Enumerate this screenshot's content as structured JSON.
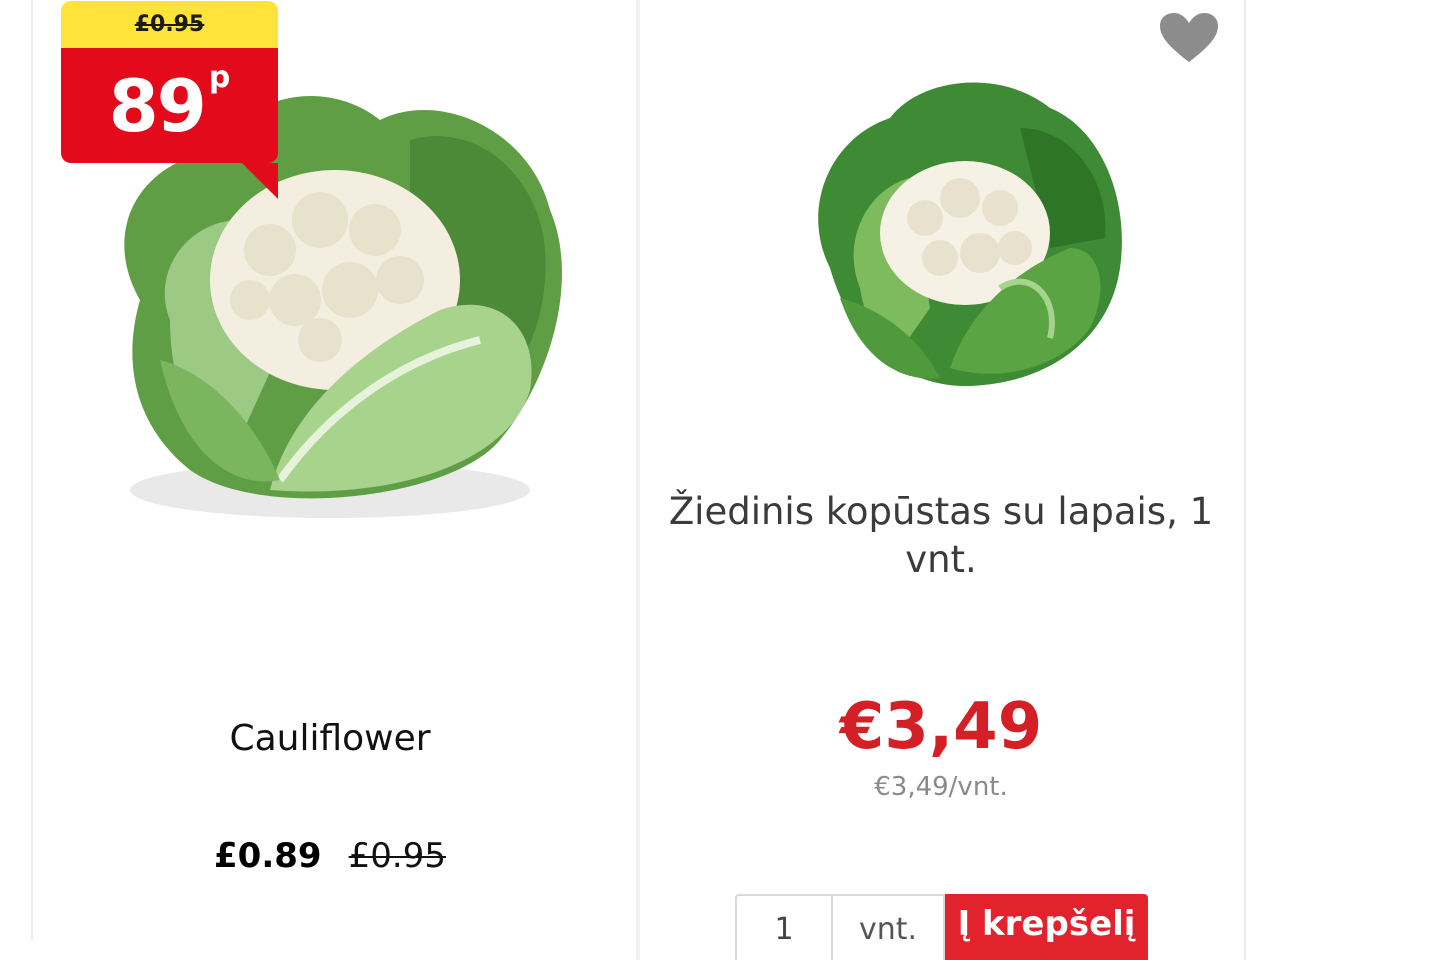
{
  "left_product": {
    "promo_badge": {
      "old_price": "£0.95",
      "price_number": "89",
      "price_unit": "p"
    },
    "image_icon": "cauliflower-photo",
    "title": "Cauliflower",
    "price_now": "£0.89",
    "price_was": "£0.95"
  },
  "right_product": {
    "favorite_icon": "heart-icon",
    "image_icon": "cauliflower-photo",
    "title": "Žiedinis kopūstas su lapais, 1 vnt.",
    "price": "€3,49",
    "unit_price": "€3,49/vnt.",
    "quantity_value": "1",
    "unit_label": "vnt.",
    "add_to_cart_label": "Į krepšelį"
  },
  "colors": {
    "promo_yellow": "#ffe23a",
    "promo_red": "#e30a1b",
    "price_red": "#d41f26",
    "button_red": "#e2222c",
    "heart_grey": "#8c8c8c"
  }
}
